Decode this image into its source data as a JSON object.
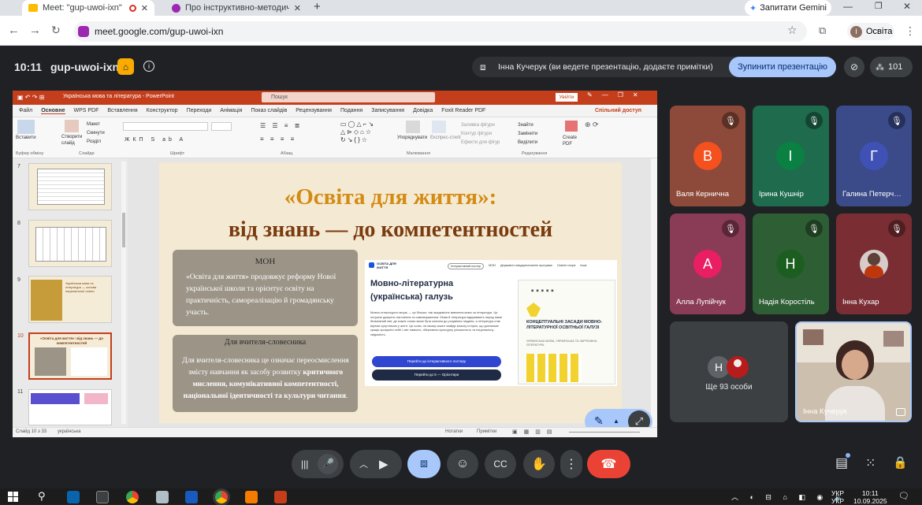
{
  "browser": {
    "tabs": [
      {
        "label": "Meet: \"gup-uwoi-ixn\""
      },
      {
        "label": "Про інструктивно-методичні р"
      }
    ],
    "gemini_label": "Запитати Gemini",
    "url": "meet.google.com/gup-uwoi-ixn",
    "profile_label": "Освіта",
    "profile_initial": "І"
  },
  "meet": {
    "time": "10:11",
    "code": "gup-uwoi-ixn",
    "presenter_text": "Інна Кучерук (ви ведете презентацію, додаєте примітки)",
    "stop_button": "Зупинити презентацію",
    "participants_count": "101",
    "participants": [
      {
        "initial": "В",
        "name": "Валя Кернична",
        "color": "#f4511e",
        "bg": "#8d4a3a"
      },
      {
        "initial": "І",
        "name": "Ірина Кушнір",
        "color": "#0b8043",
        "bg": "#1e6b4d"
      },
      {
        "initial": "Г",
        "name": "Галина Петерч…",
        "color": "#3f51b5",
        "bg": "#3b4b8a"
      },
      {
        "initial": "А",
        "name": "Алла Лупійчук",
        "color": "#e91e63",
        "bg": "#8a3b56"
      },
      {
        "initial": "Н",
        "name": "Надія Коростіль",
        "color": "#1b5e20",
        "bg": "#2e5e34"
      },
      {
        "initial": "",
        "name": "Інна Кухар",
        "color": "#ffffff",
        "bg": "#7a2e34"
      }
    ],
    "more_label": "Ще 93 особи",
    "more_initial": "Н",
    "self_name": "Інна Кучерук"
  },
  "ppt": {
    "title": "Українська мова та література  -  PowerPoint",
    "search": "Пошук",
    "signin": "Увійти",
    "share": "Спільний доступ",
    "menu": [
      "Файл",
      "Основне",
      "WPS PDF",
      "Вставлення",
      "Конструктор",
      "Переходи",
      "Анімація",
      "Показ слайдів",
      "Рецензування",
      "Подання",
      "Записування",
      "Довідка",
      "Foxit Reader PDF"
    ],
    "groups": [
      "Буфер обміну",
      "Слайди",
      "Шрифт",
      "Абзац",
      "Малювання",
      "Редагування"
    ],
    "ribbon": {
      "paste": "Вставити",
      "new_slide": "Створити слайд",
      "layout": "Макет",
      "reset": "Скинути",
      "section": "Розділ",
      "arrange": "Упорядкувати",
      "quick_styles": "Експрес-стилі",
      "fill": "Заливка фігури",
      "outline": "Контур фігури",
      "effects": "Ефекти для фігур",
      "find": "Знайти",
      "replace": "Замінити",
      "select": "Виділити",
      "create_pdf": "Create PDF"
    },
    "thumbs": [
      {
        "num": "7"
      },
      {
        "num": "8"
      },
      {
        "num": "9",
        "text": "Українська мова та література — основа національної освіти"
      },
      {
        "num": "10",
        "text": "«Освіта для життя»: від знань — до компетентностей"
      },
      {
        "num": "11"
      }
    ],
    "status": {
      "slide": "Слайд 10 з 33",
      "lang": "українська",
      "notes": "Нотатки",
      "comments": "Примітки"
    },
    "slide": {
      "title1": "«Освіта для життя»:",
      "title2": "від знань — до компетентностей",
      "box1_title": "МОН",
      "box1_text": "«Освіта для життя» продовжує реформу Нової української школи та орієнтує освіту на практичність, самореалізацію й громадянську участь.",
      "box2_title": "Для вчителя-словесника",
      "box2_text_a": "Для вчителя-словесника це означає переосмислення змісту навчання як засобу розвитку ",
      "box2_text_b": "критичного мислення, комунікативної компетентності, національної ідентичності та культури читання",
      "box2_text_c": ".",
      "web": {
        "logo": "ОСВІТА ДЛЯ ЖИТТЯ",
        "nav": [
          "Інтерактивний постер",
          "МОН",
          "Державні стандарти/освітні програми",
          "Освітні галузі",
          "Інше"
        ],
        "heading1": "Мовно-літературна",
        "heading2": "(українська) галузь",
        "para": "Мовно-літературна галузь — це більше, ніж академічне вивчення мови чи літератури. Це потужне джерело натхнення та самовираження. Мова й література відкривають перед нами безмежний світ, де кожне слово може бути ключем до розуміння людини, а література стає вірним супутником у житті. Це шлях, на якому кожен знайде власну історію, що допоможе краще зрозуміти себе і світ навколо, зберігаючи культурну унікальність та національну свідомість.",
        "btn1": "Перейти до інтерактивного постеру",
        "btn2": "Перейти до 5 — Орієнтири",
        "book_title": "КОНЦЕПТУАЛЬНІ ЗАСАДИ МОВНО-ЛІТЕРАТУРНОЇ ОСВІТНЬОЇ ГАЛУЗІ",
        "book_sub": "УКРАЇНСЬКА МОВА, УКРАЇНСЬКА ТА ЗАРУБІЖНА ЛІТЕРАТУРА"
      }
    }
  },
  "taskbar": {
    "lang1": "УКР",
    "lang2": "УКР",
    "time": "10:11",
    "date": "10.09.2025"
  }
}
